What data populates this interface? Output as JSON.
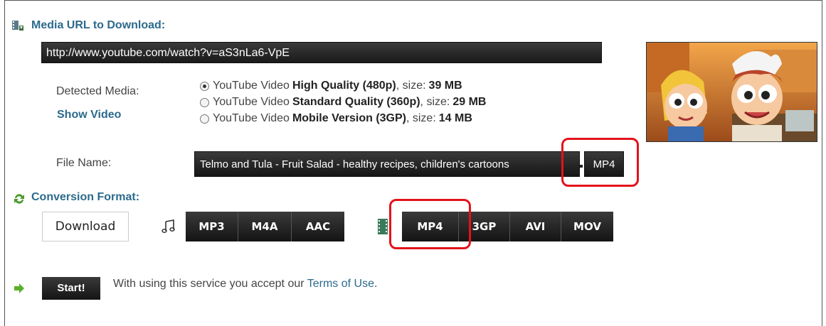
{
  "media_url": {
    "title": "Media URL to Download:",
    "value": "http://www.youtube.com/watch?v=aS3nLa6-VpE"
  },
  "detected": {
    "label": "Detected Media:",
    "show_video": "Show Video",
    "options": [
      {
        "prefix": "YouTube Video",
        "quality": "High Quality (480p)",
        "size_label": ", size:",
        "size": "39 MB",
        "selected": true
      },
      {
        "prefix": "YouTube Video",
        "quality": "Standard Quality (360p)",
        "size_label": ", size:",
        "size": "29 MB",
        "selected": false
      },
      {
        "prefix": "YouTube Video",
        "quality": "Mobile Version (3GP)",
        "size_label": ", size:",
        "size": "14 MB",
        "selected": false
      }
    ]
  },
  "file": {
    "label": "File Name:",
    "name": "Telmo and Tula - Fruit Salad - healthy recipes, children's cartoons",
    "ext": "MP4"
  },
  "conversion": {
    "title": "Conversion Format:",
    "download_label": "Download",
    "audio_formats": [
      "MP3",
      "M4A",
      "AAC"
    ],
    "video_formats": [
      "MP4",
      "3GP",
      "AVI",
      "MOV"
    ]
  },
  "start": {
    "label": "Start!",
    "terms_prefix": "With using this service you accept our",
    "terms_link": "Terms of Use",
    "terms_suffix": "."
  },
  "colors": {
    "accent": "#2c6a8c",
    "highlight": "#e3131b",
    "button_dark": "#1a1a1a"
  }
}
